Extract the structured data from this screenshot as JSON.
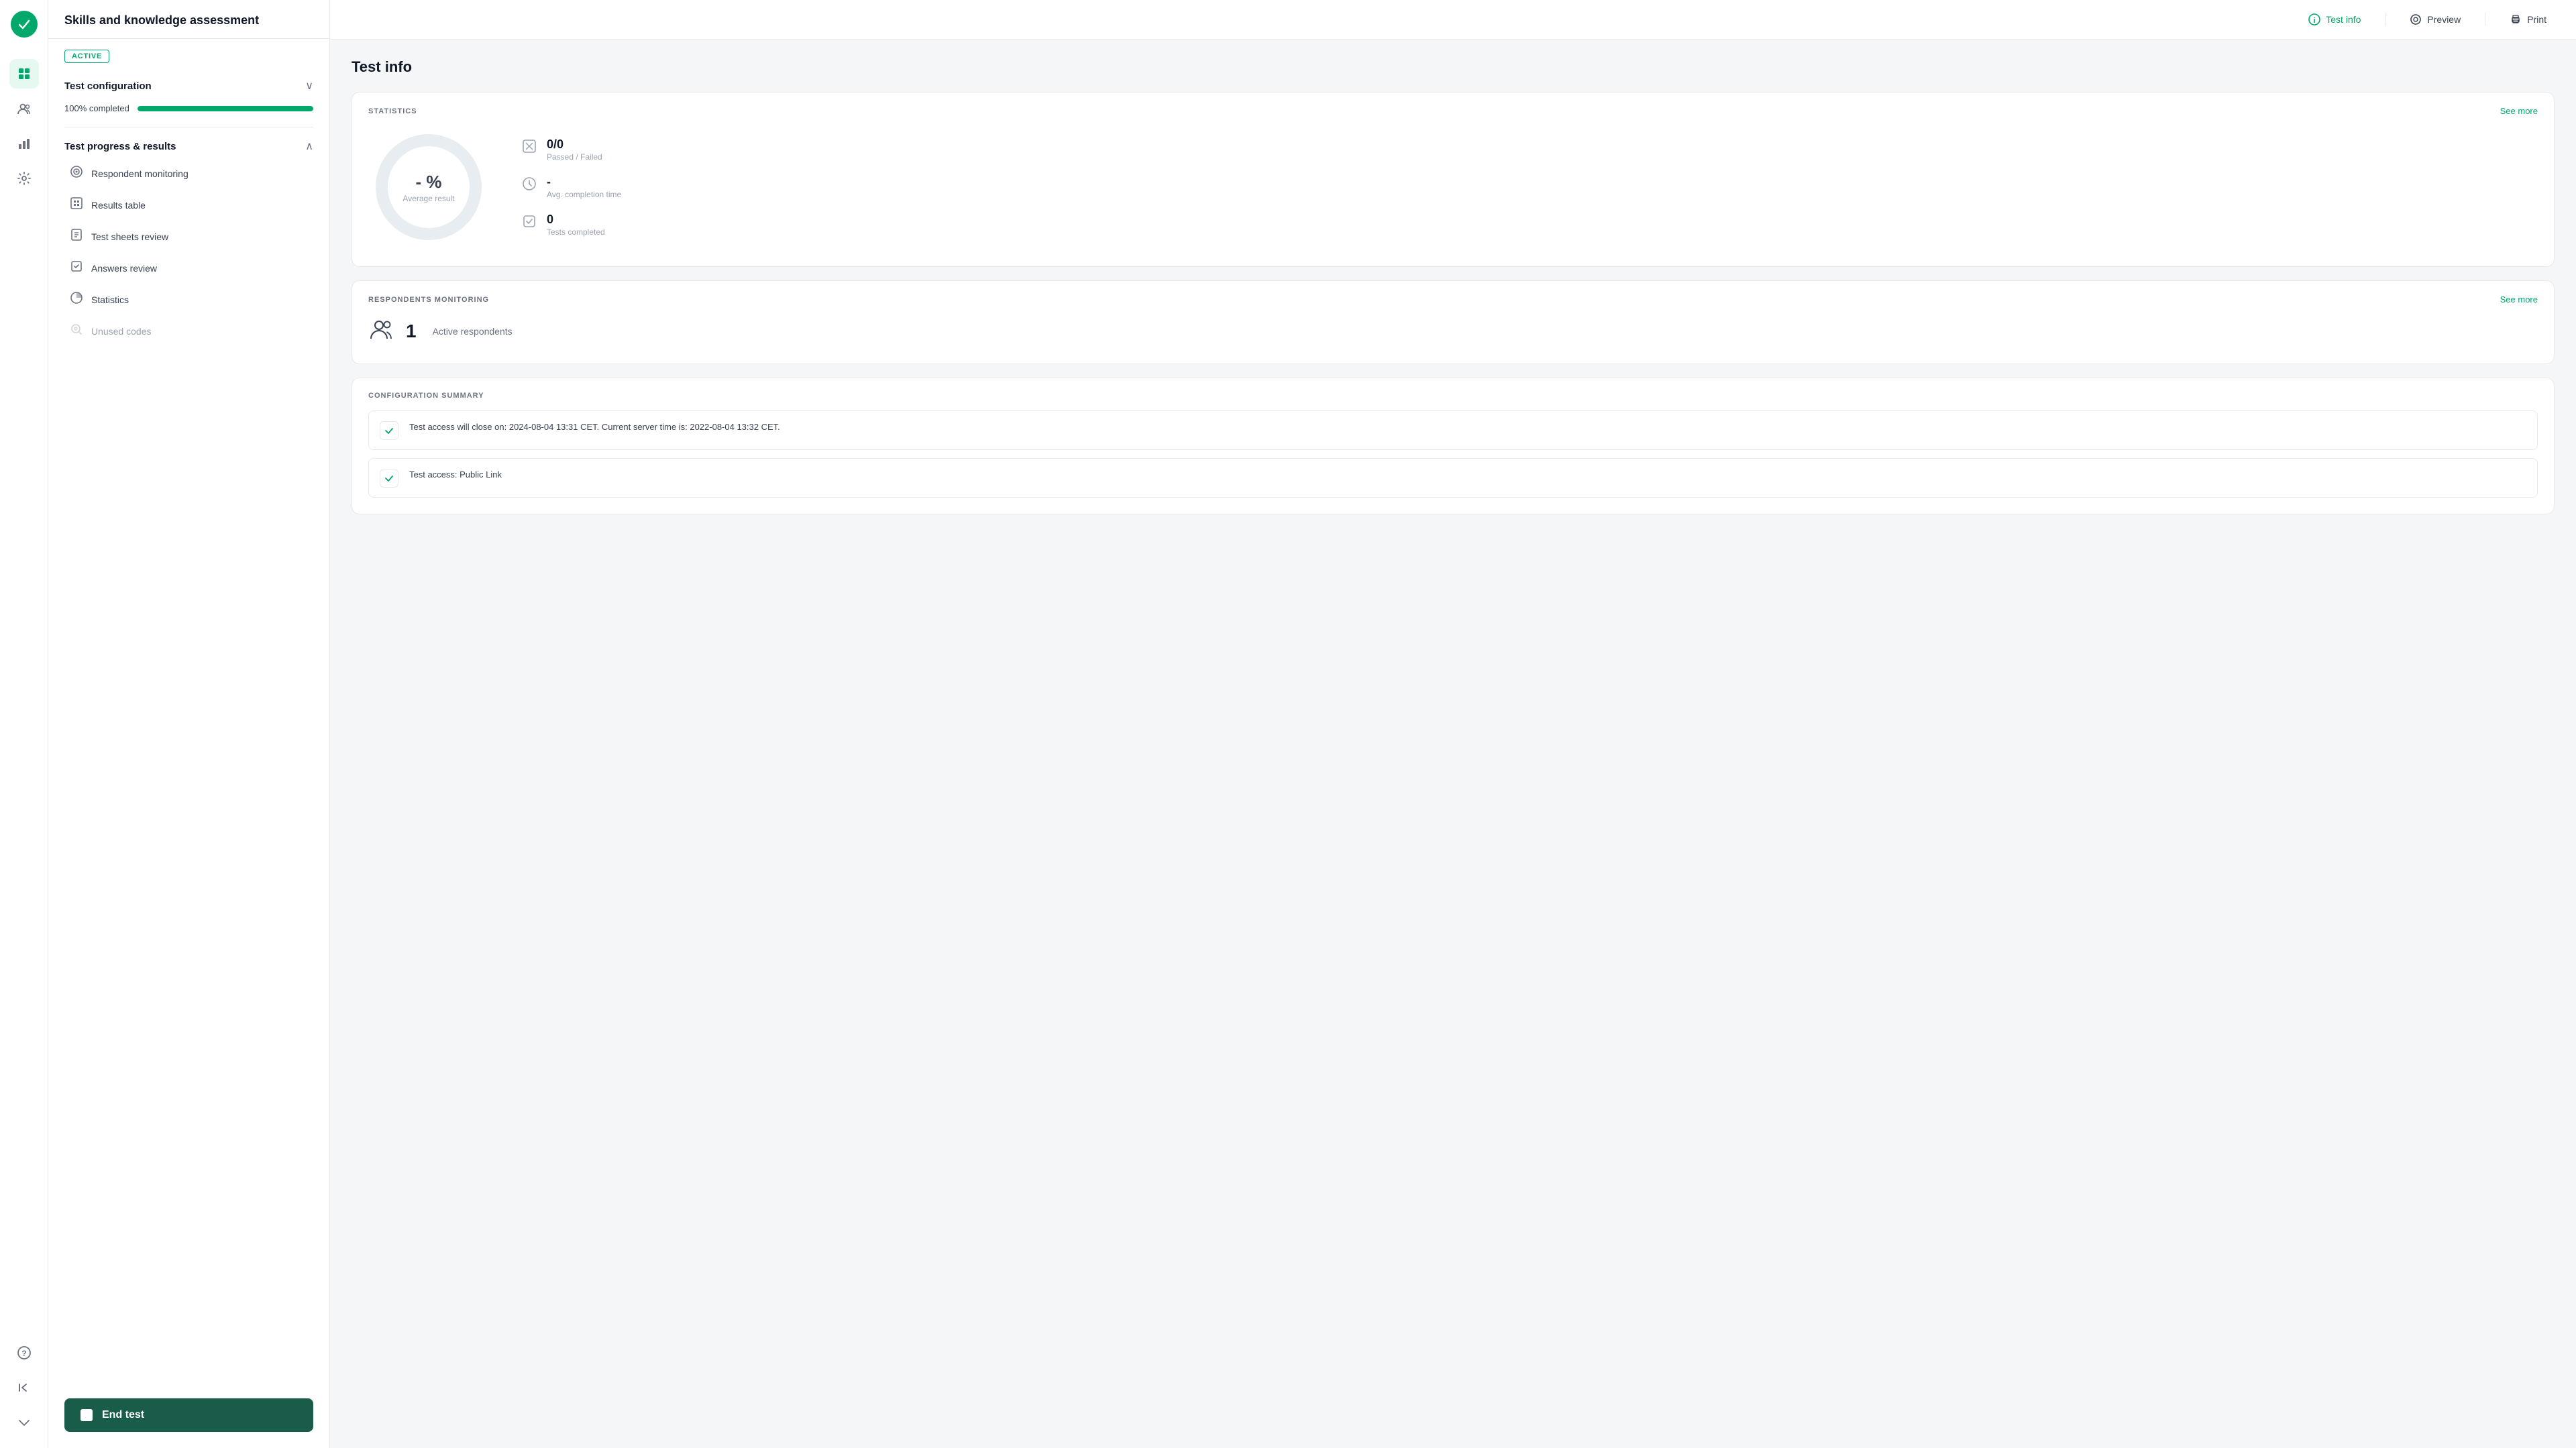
{
  "app": {
    "title": "Skills and knowledge assessment"
  },
  "sidebar": {
    "active_badge": "ACTIVE",
    "test_configuration": {
      "title": "Test configuration",
      "progress_label": "100% completed",
      "progress_value": 100
    },
    "test_progress": {
      "title": "Test progress & results",
      "nav_items": [
        {
          "id": "respondent-monitoring",
          "label": "Respondent monitoring",
          "icon": "◎",
          "disabled": false
        },
        {
          "id": "results-table",
          "label": "Results table",
          "icon": "▦",
          "disabled": false
        },
        {
          "id": "test-sheets-review",
          "label": "Test sheets review",
          "icon": "☰",
          "disabled": false
        },
        {
          "id": "answers-review",
          "label": "Answers review",
          "icon": "☑",
          "disabled": false
        },
        {
          "id": "statistics",
          "label": "Statistics",
          "icon": "◑",
          "disabled": false
        },
        {
          "id": "unused-codes",
          "label": "Unused codes",
          "icon": "🔍",
          "disabled": true
        }
      ]
    },
    "end_test_button": "End test"
  },
  "topbar": {
    "actions": [
      {
        "id": "test-info",
        "label": "Test info",
        "icon": "ℹ",
        "active": true
      },
      {
        "id": "preview",
        "label": "Preview",
        "icon": "👁"
      },
      {
        "id": "print",
        "label": "Print",
        "icon": "🖨"
      }
    ]
  },
  "content": {
    "title": "Test info",
    "statistics": {
      "section_title": "STATISTICS",
      "see_more": "See more",
      "average_result_label": "Average result",
      "average_result_value": "- %",
      "passed_failed_value": "0/0",
      "passed_failed_label": "Passed / Failed",
      "avg_time_value": "-",
      "avg_time_label": "Avg. completion time",
      "tests_completed_value": "0",
      "tests_completed_label": "Tests completed"
    },
    "respondents": {
      "section_title": "RESPONDENTS MONITORING",
      "see_more": "See more",
      "count": "1",
      "label": "Active respondents"
    },
    "config_summary": {
      "section_title": "CONFIGURATION SUMMARY",
      "items": [
        {
          "text": "Test access will close on: 2024-08-04 13:31 CET. Current server time is: 2022-08-04 13:32 CET."
        },
        {
          "text": "Test access: Public Link"
        }
      ]
    }
  },
  "icons": {
    "check": "✓",
    "chevron_down": "∨",
    "chevron_up": "∧",
    "info": "ⓘ",
    "eye": "◉",
    "print": "⎙",
    "logo_check": "✓"
  }
}
